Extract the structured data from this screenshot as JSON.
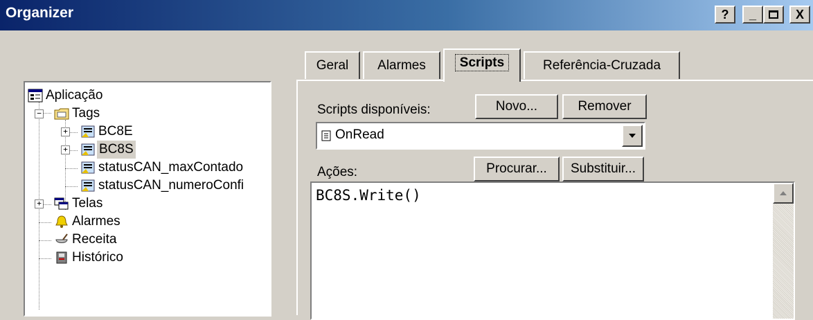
{
  "window": {
    "title": "Organizer",
    "help_label": "?",
    "minimize_label": "_",
    "maximize_label": "□",
    "close_label": "X"
  },
  "tree": {
    "root": "Aplicação",
    "tags": "Tags",
    "bc8e": "BC8E",
    "bc8s": "BC8S",
    "status_max": "statusCAN_maxContado",
    "status_num": "statusCAN_numeroConfi",
    "telas": "Telas",
    "alarmes": "Alarmes",
    "receita": "Receita",
    "historico": "Histórico"
  },
  "tabs": {
    "geral": "Geral",
    "alarmes": "Alarmes",
    "scripts": "Scripts",
    "referencia": "Referência-Cruzada"
  },
  "scripts": {
    "available_label": "Scripts disponíveis:",
    "new_button": "Novo...",
    "remove_button": "Remover",
    "selected_script": "OnRead",
    "actions_label": "Ações:",
    "search_button": "Procurar...",
    "replace_button": "Substituir...",
    "code": "BC8S.Write()"
  },
  "colors": {
    "face": "#d4d0c8",
    "title_start": "#0a246a",
    "title_end": "#a6caf0",
    "selection": "#d4d0c8"
  }
}
